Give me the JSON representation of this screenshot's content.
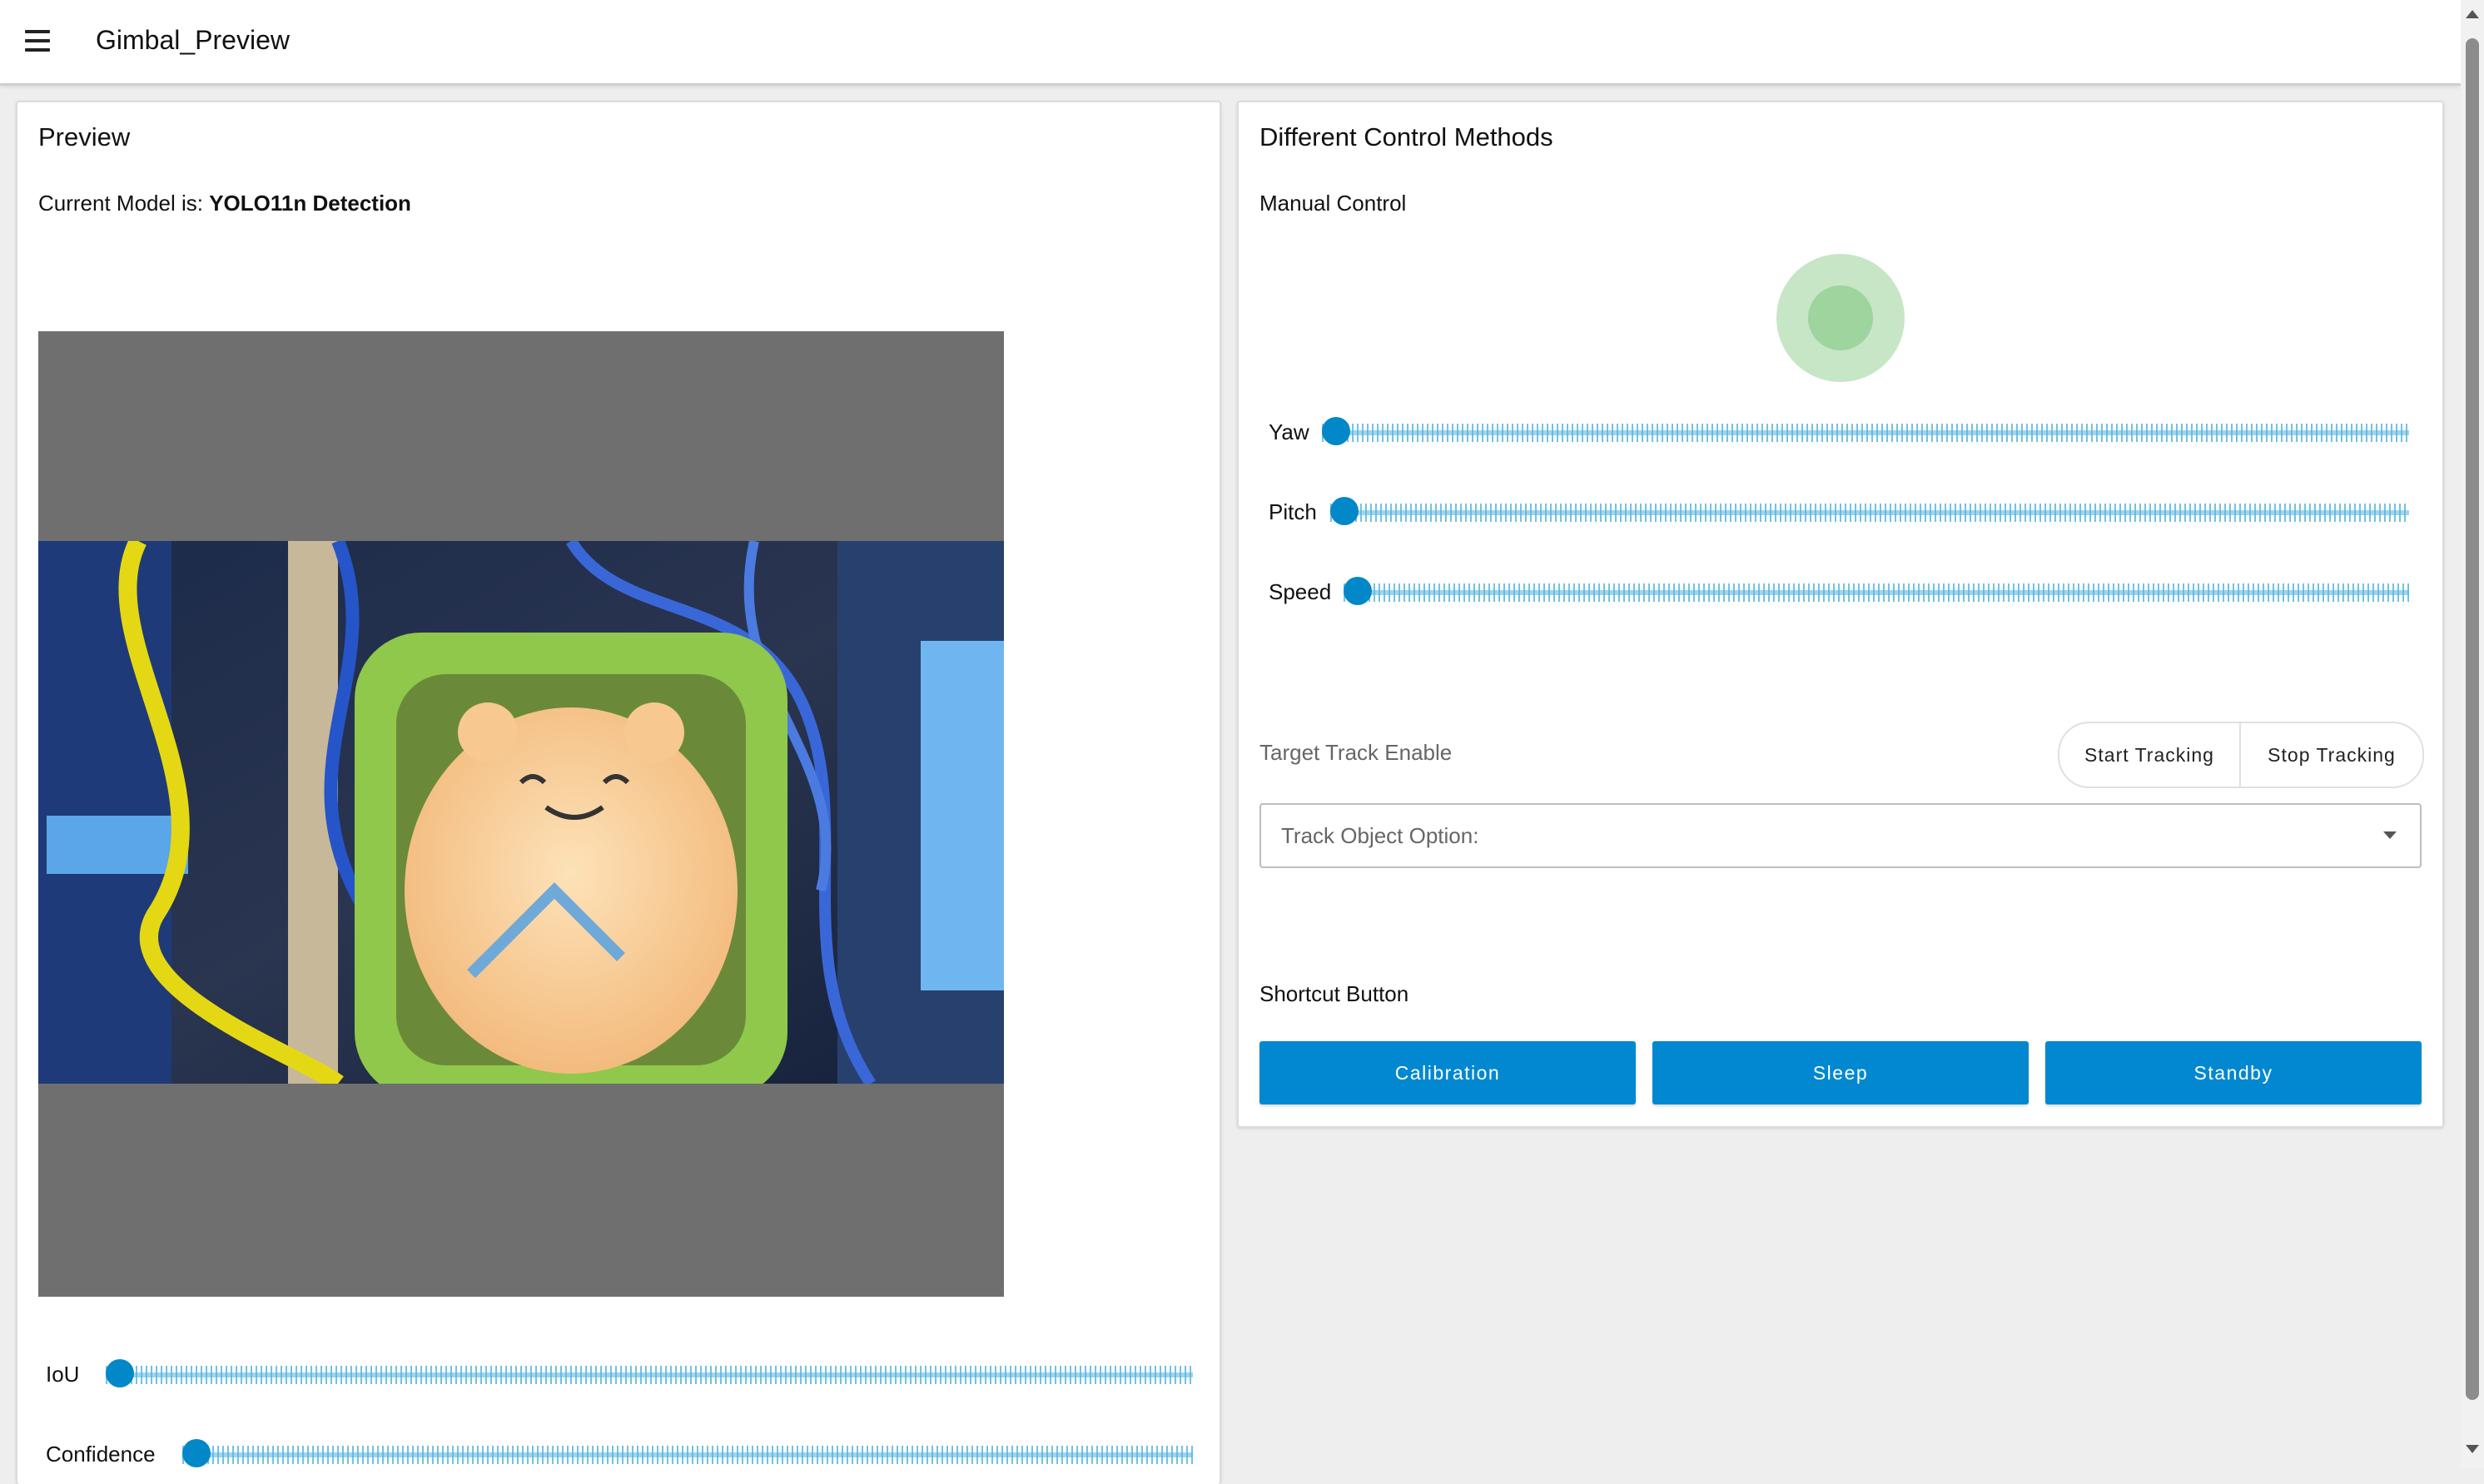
{
  "appbar": {
    "title": "Gimbal_Preview"
  },
  "preview": {
    "title": "Preview",
    "model_prefix": "Current Model is:",
    "model_name": "YOLO11n Detection",
    "sliders": [
      {
        "label": "IoU",
        "value": 0
      },
      {
        "label": "Confidence",
        "value": 0
      }
    ]
  },
  "controls": {
    "title": "Different Control Methods",
    "manual_label": "Manual Control",
    "sliders": [
      {
        "label": "Yaw",
        "value": 0
      },
      {
        "label": "Pitch",
        "value": 0
      },
      {
        "label": "Speed",
        "value": 0
      }
    ],
    "track_label": "Target Track Enable",
    "start_tracking": "Start Tracking",
    "stop_tracking": "Stop Tracking",
    "select_placeholder": "Track Object Option:",
    "shortcut_label": "Shortcut Button",
    "shortcuts": [
      "Calibration",
      "Sleep",
      "Standby"
    ]
  },
  "colors": {
    "accent": "#0288d1",
    "slider_track": "#9fd5ef",
    "joystick_outer": "#c6e6c6",
    "joystick_inner": "#9ed49e",
    "preview_bg": "#6f6f6f"
  },
  "icons": [
    "menu-icon",
    "dropdown-arrow-icon"
  ]
}
